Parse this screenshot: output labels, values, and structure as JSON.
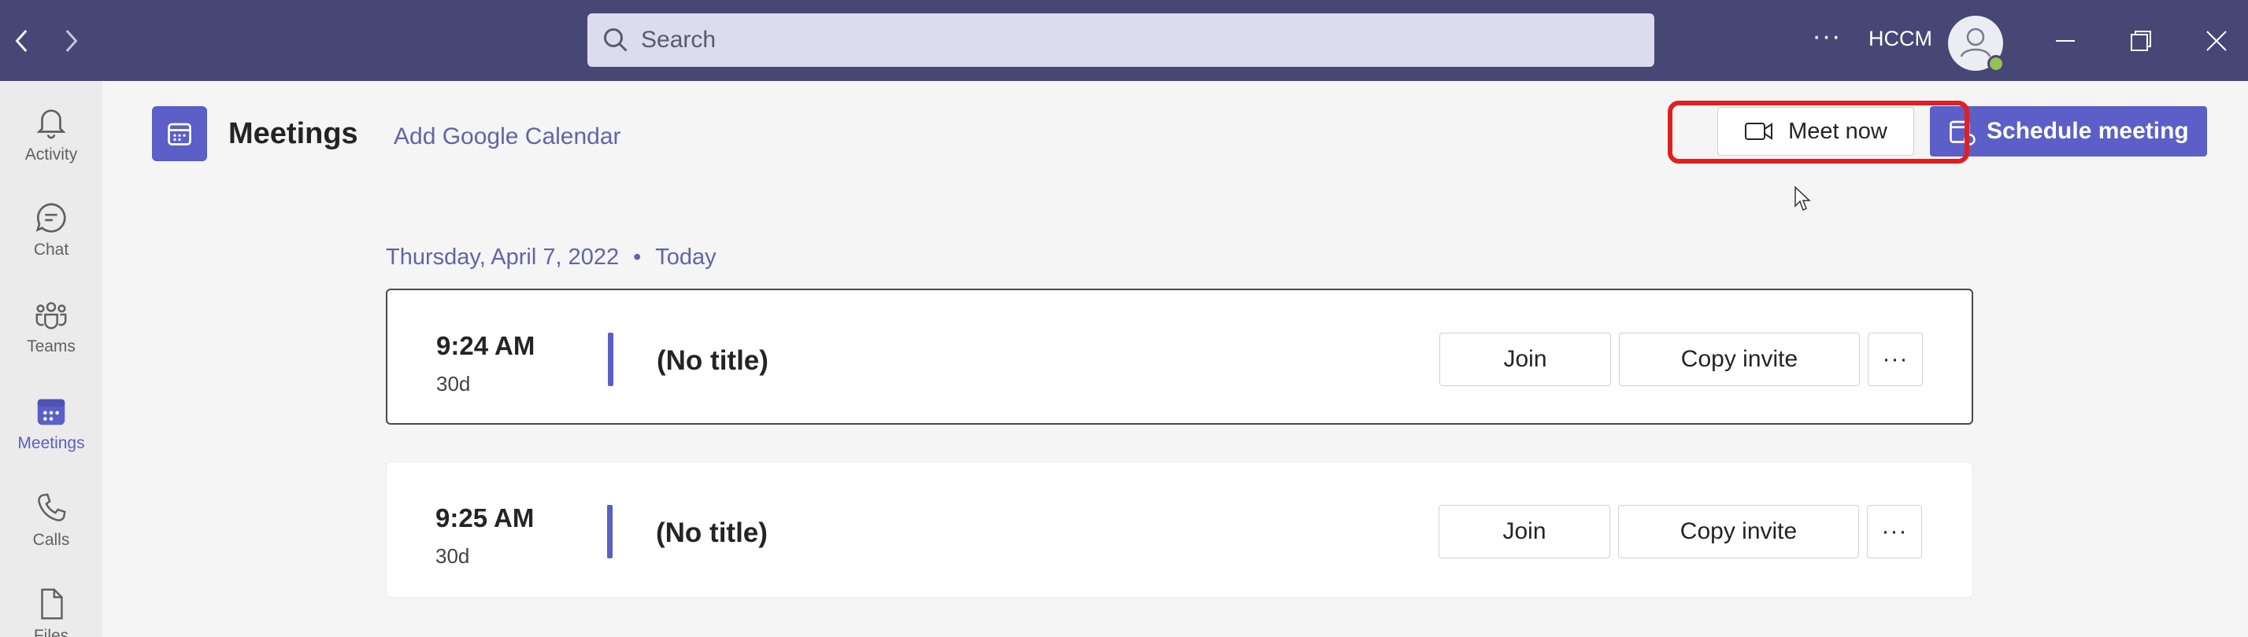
{
  "titlebar": {
    "search_placeholder": "Search",
    "org_label": "HCCM",
    "more_glyph": "···",
    "colors": {
      "bar": "#464775",
      "presence": "#92c353"
    }
  },
  "rail": {
    "items": [
      {
        "label": "Activity",
        "icon": "bell-icon"
      },
      {
        "label": "Chat",
        "icon": "chat-icon"
      },
      {
        "label": "Teams",
        "icon": "teams-icon"
      },
      {
        "label": "Meetings",
        "icon": "calendar-icon",
        "active": true
      },
      {
        "label": "Calls",
        "icon": "phone-icon"
      },
      {
        "label": "Files",
        "icon": "file-icon"
      }
    ]
  },
  "header": {
    "title": "Meetings",
    "add_calendar": "Add Google Calendar",
    "meet_now": "Meet now",
    "schedule": "Schedule meeting",
    "accent": "#5b5fc7"
  },
  "date": {
    "label": "Thursday, April 7, 2022",
    "separator": "•",
    "today": "Today"
  },
  "meetings": [
    {
      "time": "9:24 AM",
      "duration": "30d",
      "title": "(No title)",
      "join": "Join",
      "copy": "Copy invite",
      "more": "···",
      "selected": true
    },
    {
      "time": "9:25 AM",
      "duration": "30d",
      "title": "(No title)",
      "join": "Join",
      "copy": "Copy invite",
      "more": "···",
      "selected": false
    }
  ]
}
